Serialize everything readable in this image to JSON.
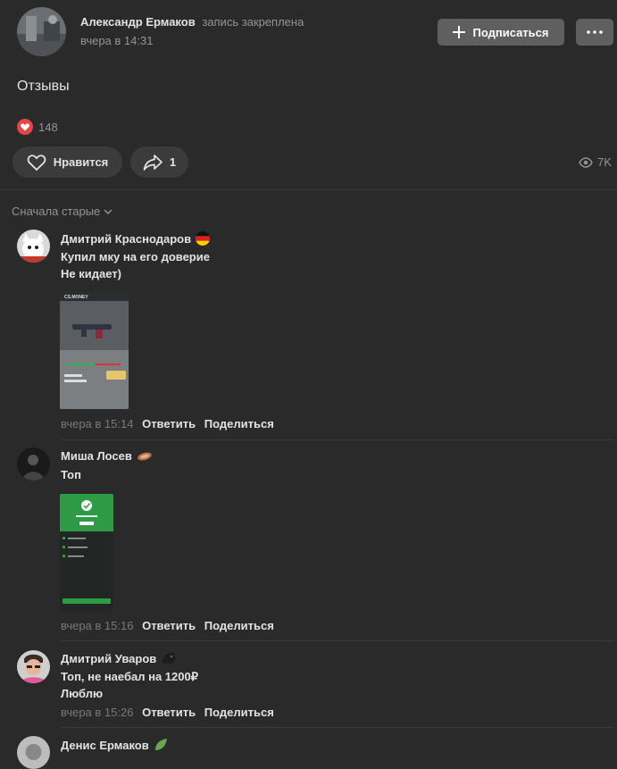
{
  "post": {
    "author": "Александр Ермаков",
    "pinned_label": "запись закреплена",
    "time": "вчера в 14:31",
    "subscribe_label": "Подписаться",
    "text": "Отзывы",
    "likes_count": "148",
    "like_label": "Нравится",
    "share_count": "1",
    "views": "7K"
  },
  "sort_label": "Сначала старые",
  "comments": [
    {
      "name": "Дмитрий Краснодаров",
      "lines": [
        "Купил мку на его доверие",
        "Не кидает)"
      ],
      "time": "вчера в 15:14",
      "reply": "Ответить",
      "share": "Поделиться",
      "thumb_brand": "CS.MONEY"
    },
    {
      "name": "Миша Лосев",
      "lines": [
        "Топ"
      ],
      "time": "вчера в 15:16",
      "reply": "Ответить",
      "share": "Поделиться"
    },
    {
      "name": "Дмитрий Уваров",
      "lines": [
        "Топ, не наебал на 1200₽",
        "Люблю"
      ],
      "time": "вчера в 15:26",
      "reply": "Ответить",
      "share": "Поделиться"
    },
    {
      "name": "Денис Ермаков"
    }
  ],
  "icons": [
    "plus-icon",
    "more-icon",
    "heart-icon",
    "share-icon",
    "eye-icon",
    "chevron-down-icon"
  ],
  "colors": {
    "background": "#2a2a2b",
    "button": "#5d5f61",
    "pill": "#3b3b3c",
    "heart": "#e64646"
  }
}
